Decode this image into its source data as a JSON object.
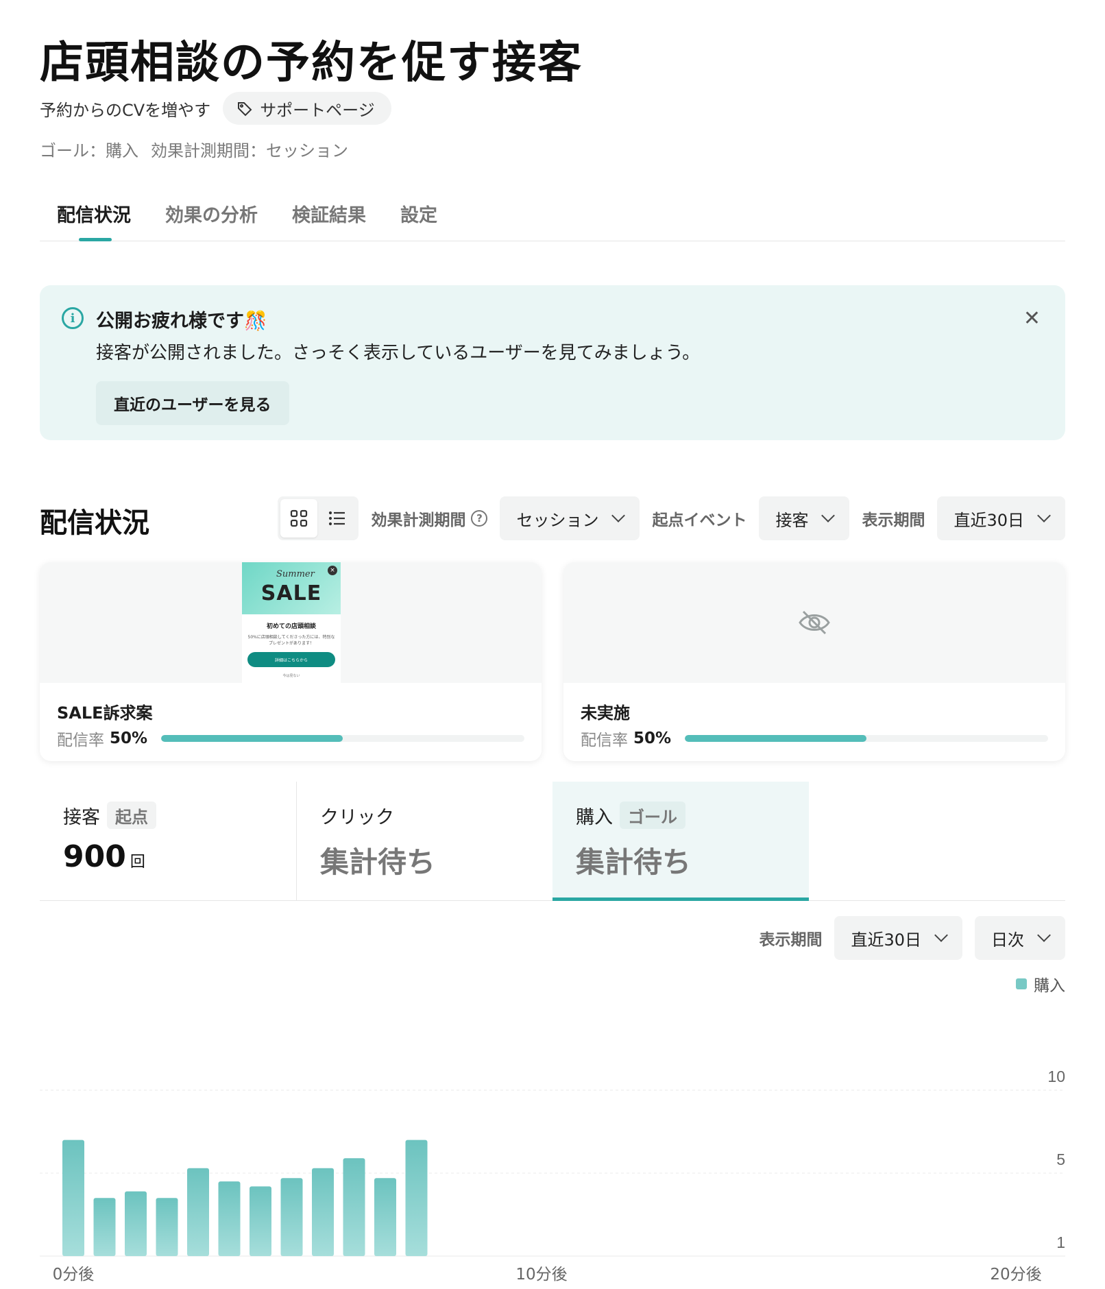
{
  "header": {
    "title": "店頭相談の予約を促す接客",
    "subtitle": "予約からのCVを増やす",
    "support_label": "サポートページ",
    "goal": "ゴール：購入",
    "period": "効果計測期間：セッション"
  },
  "tabs": [
    {
      "label": "配信状況",
      "active": true
    },
    {
      "label": "効果の分析",
      "active": false
    },
    {
      "label": "検証結果",
      "active": false
    },
    {
      "label": "設定",
      "active": false
    }
  ],
  "banner": {
    "title": "公開お疲れ様です🎊",
    "body": "接客が公開されました。さっそく表示しているユーザーを見てみましょう。",
    "button": "直近のユーザーを見る"
  },
  "delivery": {
    "section_title": "配信状況",
    "measure_label": "効果計測期間",
    "measure_value": "セッション",
    "start_event_label": "起点イベント",
    "start_event_value": "接客",
    "display_period_label": "表示期間",
    "display_period_value": "直近30日"
  },
  "variants": [
    {
      "name": "SALE訴求案",
      "rate_label": "配信率",
      "rate_value": "50%",
      "rate": 0.5,
      "preview": {
        "script": "Summer",
        "headline": "SALE",
        "title": "初めての店頭相談",
        "body": "50%に店頭相談してくださった方には、特別なプレゼントがあります！",
        "button": "詳細はこちらから",
        "dismiss": "今は見ない"
      }
    },
    {
      "name": "未実施",
      "rate_label": "配信率",
      "rate_value": "50%",
      "rate": 0.5
    }
  ],
  "metrics": [
    {
      "label": "接客",
      "badge": "起点",
      "value": "900",
      "unit": "回"
    },
    {
      "label": "クリック",
      "pending": "集計待ち"
    },
    {
      "label": "購入",
      "badge": "ゴール",
      "pending": "集計待ち"
    }
  ],
  "chart_controls": {
    "label": "表示期間",
    "period": "直近30日",
    "granularity": "日次"
  },
  "chart_data": {
    "type": "bar",
    "series": [
      {
        "name": "購入",
        "color": "#78c9c5",
        "values": [
          7,
          3.5,
          3.9,
          3.5,
          5.3,
          4.5,
          4.2,
          4.7,
          5.3,
          5.9,
          4.7,
          7
        ]
      }
    ],
    "x_tick_labels": [
      "0分後",
      "10分後",
      "20分後"
    ],
    "y_tick_labels": [
      "10",
      "5",
      "1"
    ],
    "ylim": [
      0,
      10
    ],
    "grid": true,
    "legend": "top-right"
  }
}
